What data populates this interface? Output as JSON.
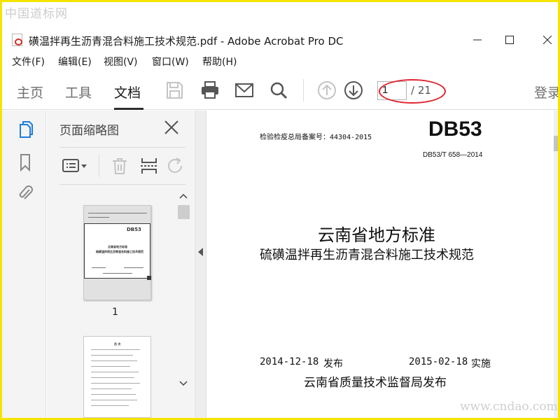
{
  "watermarks": {
    "top": "中国道标网",
    "bottom": "www.cndao.com"
  },
  "window": {
    "title": "磺温拌再生沥青混合料施工技术规范.pdf - Adobe Acrobat Pro DC"
  },
  "menu": [
    "文件(F)",
    "编辑(E)",
    "视图(V)",
    "窗口(W)",
    "帮助(H)"
  ],
  "toolbar": {
    "tabs": [
      "主页",
      "工具",
      "文档"
    ],
    "active_tab": "文档",
    "page_current": "1",
    "page_total": "/ 21",
    "signin": "登录",
    "annotation_color": "#e0232e"
  },
  "thumbnails_panel": {
    "title": "页面缩略图",
    "thumb1_label": "1",
    "thumb1": {
      "code": "DB53",
      "line1": "云南省地方标准",
      "line2": "硫磺温拌再生沥青混合料施工技术规范"
    },
    "thumb2_title": "目 次"
  },
  "document": {
    "record_no": "检验检疫总局备案号：44304-2015",
    "code": "DB53",
    "std_no": "DB53/T 658—2014",
    "title_main": "云南省地方标准",
    "title_sub": "硫磺温拌再生沥青混合料施工技术规范",
    "issue_date": "2014-12-18",
    "issue_label": "发布",
    "impl_date": "2015-02-18",
    "impl_label": "实施",
    "publisher": "云南省质量技术监督局发布"
  },
  "icons": {
    "accent": "#1e7dd8",
    "toolbar_gray": "#6e6e6e",
    "disabled_gray": "#c4c4c4"
  }
}
